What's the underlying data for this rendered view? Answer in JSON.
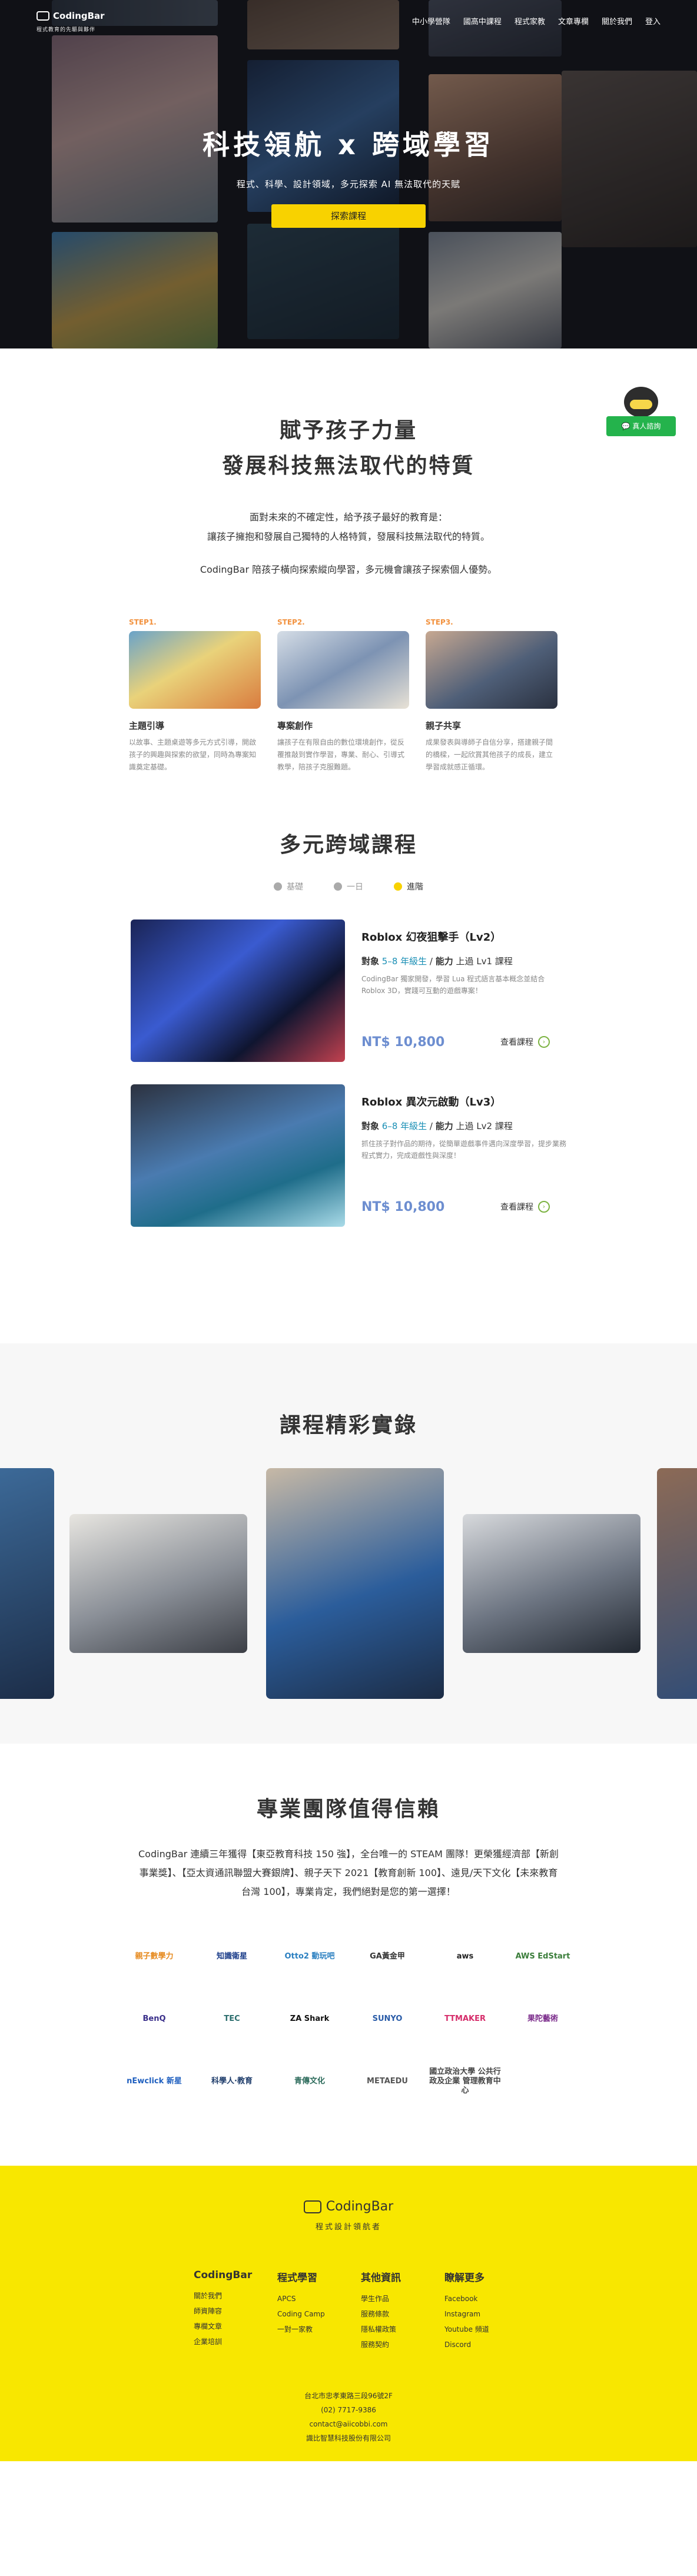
{
  "header": {
    "brand": "CodingBar",
    "brand_sub": "程式教育的先驅與夥伴",
    "nav": [
      "中小學營隊",
      "國高中課程",
      "程式家教",
      "文章專欄",
      "關於我們",
      "登入"
    ]
  },
  "hero": {
    "title": "科技領航 x 跨域學習",
    "subtitle": "程式、科學、設計領域，多元探索 AI 無法取代的天賦",
    "cta": "探索課程"
  },
  "chatbot": {
    "label": "真人諮詢"
  },
  "features": {
    "title_line1": "賦予孩子力量",
    "title_line2": "發展科技無法取代的特質",
    "desc_line1": "面對未來的不確定性，給予孩子最好的教育是：",
    "desc_line2": "讓孩子擁抱和發展自己獨特的人格特質，發展科技無法取代的特質。",
    "desc_line3": "CodingBar 陪孩子橫向探索縱向學習，多元機會讓孩子探索個人優勢。",
    "steps": [
      {
        "label": "STEP1.",
        "title": "主題引導",
        "text": "以故事、主題桌遊等多元方式引導，開啟孩子的興趣與探索的欲望，同時為專案知識奠定基礎。"
      },
      {
        "label": "STEP2.",
        "title": "專案創作",
        "text": "讓孩子在有限自由的數位環境創作，從反覆推敲到實作學習，專業、耐心、引導式教學，陪孩子克服難題。"
      },
      {
        "label": "STEP3.",
        "title": "親子共享",
        "text": "成果發表與導師子自信分享，搭建親子間的橋樑，一起欣賞其他孩子的成長，建立學習成就感正循環。"
      }
    ]
  },
  "courses": {
    "title": "多元跨域課程",
    "tabs": [
      "基礎",
      "一日",
      "進階"
    ],
    "active_tab": "進階",
    "items": [
      {
        "title": "Roblox 幻夜狙擊手（Lv2）",
        "target_label": "對象",
        "target": "5–8 年級生",
        "ability_label": "能力",
        "ability": "上過 Lv1 課程",
        "text": "CodingBar 獨家開發，學習 Lua 程式語言基本概念並結合 Roblox 3D，實踐可互動的遊戲專案！",
        "price": "NT$ 10,800",
        "more": "查看課程"
      },
      {
        "title": "Roblox 異次元啟動（Lv3）",
        "target_label": "對象",
        "target": "6–8 年級生",
        "ability_label": "能力",
        "ability": "上過 Lv2 課程",
        "text": "抓住孩子對作品的期待，從簡單遊戲事件邁向深度學習，提步業務程式實力，完成遊戲性與深度！",
        "price": "NT$ 10,800",
        "more": "查看課程"
      }
    ]
  },
  "gallery": {
    "title": "課程精彩實錄"
  },
  "team": {
    "title": "專業團隊值得信賴",
    "text": "CodingBar 連續三年獲得【東亞教育科技 150 強】，全台唯一的 STEAM 團隊！更榮獲經濟部【新創事業獎】、【亞太資通訊聯盟大賽銀牌】、親子天下 2021【教育創新 100】、遠見/天下文化【未來教育台灣 100】，專業肯定，我們絕對是您的第一選擇！",
    "logos": [
      {
        "name": "親子數學力",
        "color": "#e68a1f"
      },
      {
        "name": "知識衛星",
        "color": "#1c3e8a"
      },
      {
        "name": "Otto2 動玩吧",
        "color": "#2a7fc0"
      },
      {
        "name": "GA黃金甲",
        "color": "#333333"
      },
      {
        "name": "aws",
        "color": "#222222"
      },
      {
        "name": "AWS EdStart",
        "color": "#3a7d3a"
      },
      {
        "name": "BenQ",
        "color": "#3a2f8a"
      },
      {
        "name": "TEC",
        "color": "#2b6d6d"
      },
      {
        "name": "ZA Shark",
        "color": "#111111"
      },
      {
        "name": "SUNYO",
        "color": "#2a5ca8"
      },
      {
        "name": "TTMAKER",
        "color": "#d62c6a"
      },
      {
        "name": "果陀藝術",
        "color": "#7a2a8a"
      },
      {
        "name": "nEwclick 新星",
        "color": "#1f5fbf"
      },
      {
        "name": "科學人·教育",
        "color": "#1f3d6b"
      },
      {
        "name": "青傳文化",
        "color": "#2b6a5a"
      },
      {
        "name": "METAEDU",
        "color": "#555555"
      },
      {
        "name": "國立政治大學 公共行政及企業 管理教育中心",
        "color": "#444444"
      }
    ]
  },
  "footer": {
    "brand": "CodingBar",
    "sub": "程式設計領航者",
    "columns": [
      {
        "title": "CodingBar",
        "links": [
          "關於我們",
          "師資陣容",
          "專欄文章",
          "企業培訓"
        ]
      },
      {
        "title": "程式學習",
        "links": [
          "APCS",
          "Coding Camp",
          "一對一家教"
        ]
      },
      {
        "title": "其他資訊",
        "links": [
          "學生作品",
          "服務條款",
          "隱私權政策",
          "服務契約"
        ]
      },
      {
        "title": "瞭解更多",
        "links": [
          "Facebook",
          "Instagram",
          "Youtube 頻道",
          "Discord"
        ]
      }
    ],
    "address": "台北市忠孝東路三段96號2F",
    "phone": "(02) 7717-9386",
    "email": "contact@aiicobbi.com",
    "company": "識比智慧科技股份有限公司"
  }
}
